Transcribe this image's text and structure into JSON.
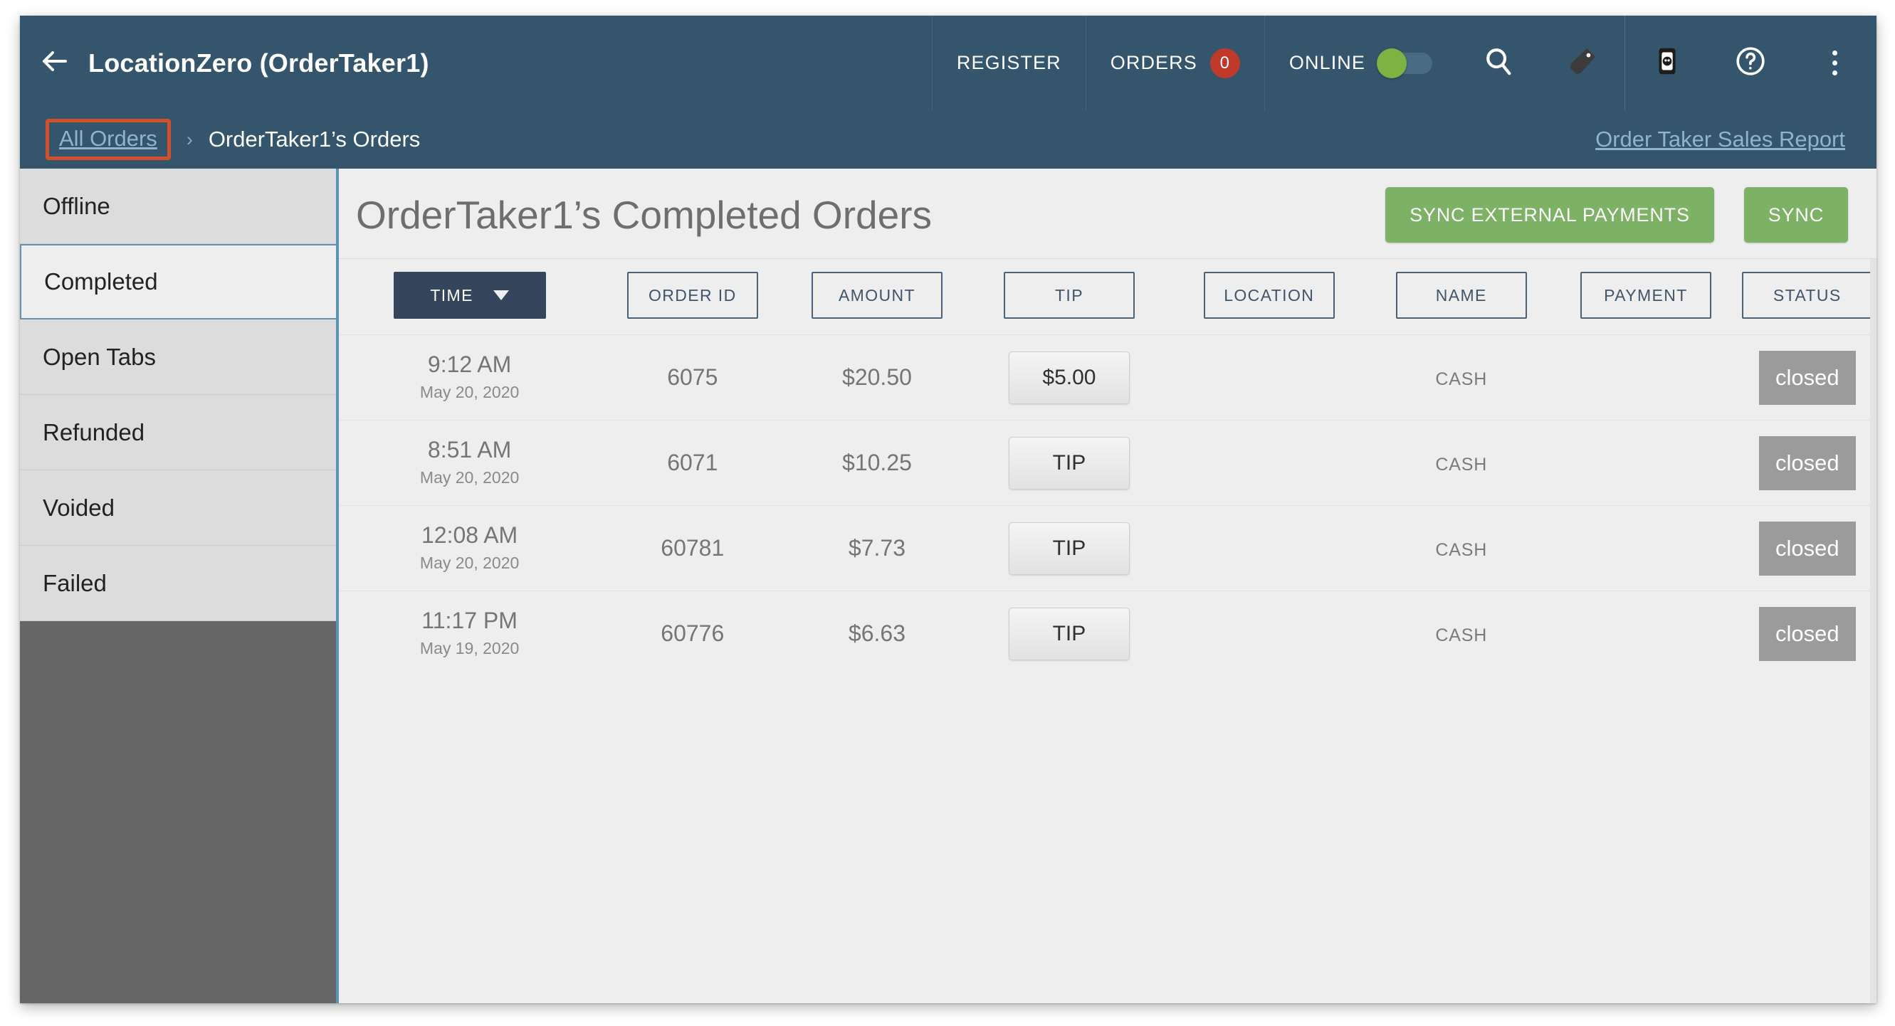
{
  "appbar": {
    "back_icon": "arrow-left-icon",
    "title": "LocationZero (OrderTaker1)",
    "register_label": "REGISTER",
    "orders_label": "ORDERS",
    "orders_badge": "0",
    "online_label": "ONLINE",
    "online_state": "on",
    "search_icon": "search-icon",
    "tag_icon": "tag-icon",
    "device_icon": "device-icon",
    "help_icon": "help-circle-icon",
    "more_icon": "kebab-menu-icon",
    "background": "#34556b",
    "badge_color": "#c0392b",
    "toggle_color": "#7cb342"
  },
  "breadcrumb": {
    "link_label": "All Orders",
    "separator": "›",
    "current_label": "OrderTaker1’s Orders",
    "report_link_label": "Order Taker Sales Report",
    "highlight_color": "#d2502a"
  },
  "sidebar": {
    "items": [
      {
        "label": "Offline",
        "selected": false
      },
      {
        "label": "Completed",
        "selected": true
      },
      {
        "label": "Open Tabs",
        "selected": false
      },
      {
        "label": "Refunded",
        "selected": false
      },
      {
        "label": "Voided",
        "selected": false
      },
      {
        "label": "Failed",
        "selected": false
      }
    ],
    "accent_color": "#5c93b5",
    "filler_color": "#666666"
  },
  "main": {
    "page_title": "OrderTaker1’s Completed Orders",
    "sync_external_label": "SYNC EXTERNAL PAYMENTS",
    "sync_label": "SYNC",
    "button_color": "#7cb166"
  },
  "table": {
    "columns": [
      {
        "label": "TIME",
        "active": true,
        "sort": "desc"
      },
      {
        "label": "ORDER ID",
        "active": false
      },
      {
        "label": "AMOUNT",
        "active": false
      },
      {
        "label": "TIP",
        "active": false
      },
      {
        "label": "LOCATION",
        "active": false
      },
      {
        "label": "NAME",
        "active": false
      },
      {
        "label": "PAYMENT",
        "active": false
      },
      {
        "label": "STATUS",
        "active": false
      }
    ],
    "rows": [
      {
        "time": "9:12 AM",
        "date": "May 20, 2020",
        "order_id": "6075",
        "amount": "$20.50",
        "tip": "$5.00",
        "location": "",
        "name": "CASH",
        "payment": "",
        "status": "closed"
      },
      {
        "time": "8:51 AM",
        "date": "May 20, 2020",
        "order_id": "6071",
        "amount": "$10.25",
        "tip": "TIP",
        "location": "",
        "name": "CASH",
        "payment": "",
        "status": "closed"
      },
      {
        "time": "12:08 AM",
        "date": "May 20, 2020",
        "order_id": "60781",
        "amount": "$7.73",
        "tip": "TIP",
        "location": "",
        "name": "CASH",
        "payment": "",
        "status": "closed"
      },
      {
        "time": "11:17 PM",
        "date": "May 19, 2020",
        "order_id": "60776",
        "amount": "$6.63",
        "tip": "TIP",
        "location": "",
        "name": "CASH",
        "payment": "",
        "status": "closed"
      }
    ],
    "status_badge_color": "#9b9b9b"
  }
}
